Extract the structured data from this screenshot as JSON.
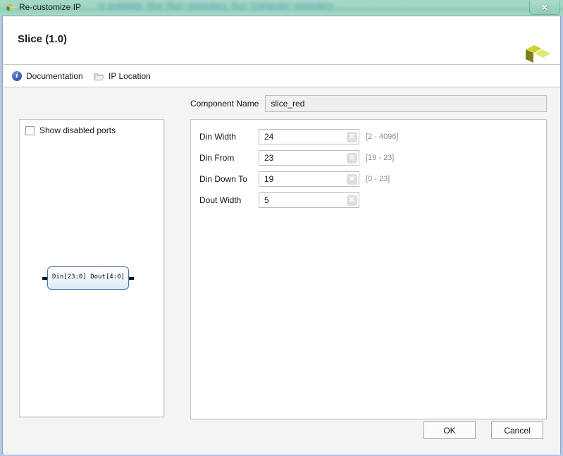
{
  "window": {
    "title": "Re-customize IP",
    "title_icon": "xilinx-logo-icon",
    "close_label": "✕",
    "background_blur_text": "is available.  Run 'Run' reminders.  Run 'Computer' reminders.",
    "border_color": "#b6c7e2",
    "titlebar_color": "#9ed5c1"
  },
  "header": {
    "title": "Slice (1.0)",
    "logo": "xilinx-logo-icon"
  },
  "toolbar": {
    "documentation_label": "Documentation",
    "documentation_icon": "info-icon",
    "ip_location_label": "IP Location",
    "ip_location_icon": "folder-icon"
  },
  "preview": {
    "show_disabled_ports_label": "Show disabled ports",
    "show_disabled_ports_checked": false,
    "block": {
      "input_port": "Din[23:0]",
      "output_port": "Dout[4:0]"
    }
  },
  "options": {
    "component_name_label": "Component Name",
    "component_name_value": "slice_red",
    "params": [
      {
        "label": "Din Width",
        "value": "24",
        "range": "[2 - 4096]",
        "clear": "✕"
      },
      {
        "label": "Din From",
        "value": "23",
        "range": "[19 - 23]",
        "clear": "✕"
      },
      {
        "label": "Din Down To",
        "value": "19",
        "range": "[0 - 23]",
        "clear": "✕"
      },
      {
        "label": "Dout Width",
        "value": "5",
        "range": "",
        "clear": "✕"
      }
    ]
  },
  "footer": {
    "ok_label": "OK",
    "cancel_label": "Cancel"
  }
}
